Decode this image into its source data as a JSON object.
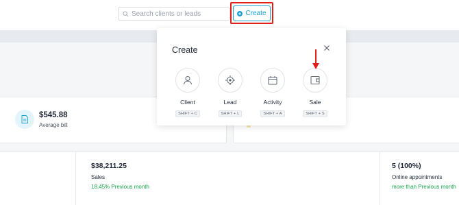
{
  "header": {
    "search_placeholder": "Search clients or leads",
    "create_label": "Create"
  },
  "dashboard": {
    "average_bill": {
      "value": "$545.88",
      "label": "Average bill"
    },
    "right_card_partial_text": "...",
    "sales": {
      "value": "$38,211.25",
      "label": "Sales",
      "delta": "18.45% Previous month"
    },
    "online": {
      "value": "5 (100%)",
      "label": "Online appointments",
      "delta": "more than Previous month"
    }
  },
  "create_modal": {
    "title": "Create",
    "options": [
      {
        "label": "Client",
        "shortcut": "SHIFT + C",
        "icon": "user-icon"
      },
      {
        "label": "Lead",
        "shortcut": "SHIFT + L",
        "icon": "target-icon"
      },
      {
        "label": "Activity",
        "shortcut": "SHIFT + A",
        "icon": "calendar-icon"
      },
      {
        "label": "Sale",
        "shortcut": "SHIFT + S",
        "icon": "wallet-icon"
      }
    ]
  },
  "colors": {
    "accent": "#1a9fd4",
    "highlight": "#e0201b",
    "positive": "#16a34a"
  }
}
